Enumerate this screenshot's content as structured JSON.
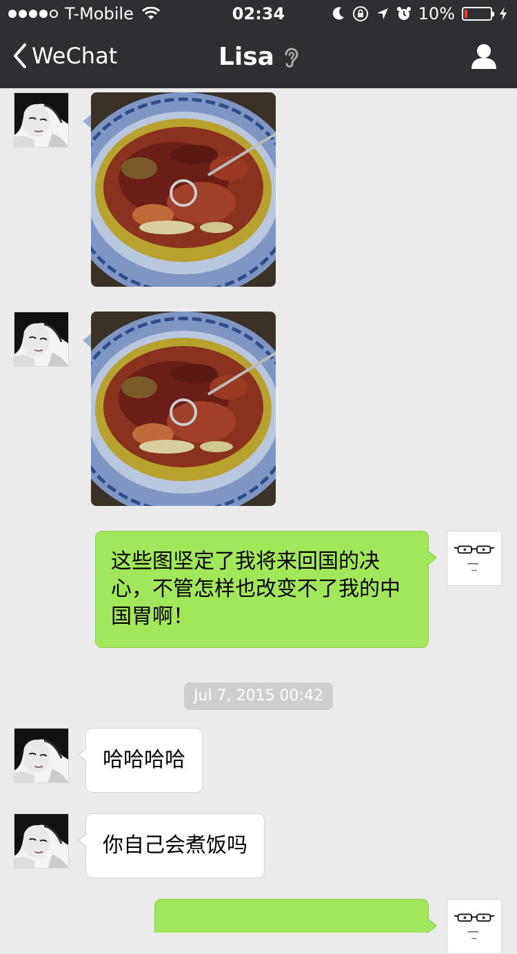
{
  "status_bar": {
    "carrier": "T-Mobile",
    "signal_bars": 4,
    "time": "02:34",
    "battery_percent": "10%",
    "battery_level": 0.1,
    "icons": [
      "wifi-icon",
      "moon-icon",
      "rotation-lock-icon",
      "location-arrow-icon",
      "alarm-icon",
      "charging-bolt-icon"
    ]
  },
  "nav": {
    "back_label": "WeChat",
    "title": "Lisa",
    "icons": [
      "chevron-left-icon",
      "ear-icon",
      "person-icon"
    ]
  },
  "chat": {
    "messages": [
      {
        "sender": "Lisa",
        "type": "image",
        "subject": "sichuan-fish-dish-photo"
      },
      {
        "sender": "Lisa",
        "type": "image",
        "subject": "sichuan-fish-dish-photo"
      },
      {
        "sender": "me",
        "type": "text",
        "text": "这些图坚定了我将来回国的决心，不管怎样也改变不了我的中国胃啊！"
      },
      {
        "sender": "Lisa",
        "type": "text",
        "text": "哈哈哈哈"
      },
      {
        "sender": "Lisa",
        "type": "text",
        "text": "你自己会煮饭吗"
      },
      {
        "sender": "me",
        "type": "text",
        "text": ""
      }
    ],
    "timestamp": "Jul 7, 2015 00:42"
  },
  "colors": {
    "nav_background": "#2e2e33",
    "chat_background": "#ebebeb",
    "outgoing_bubble": "#a0e75a",
    "incoming_bubble": "#ffffff",
    "battery_low": "#ff3b30"
  }
}
